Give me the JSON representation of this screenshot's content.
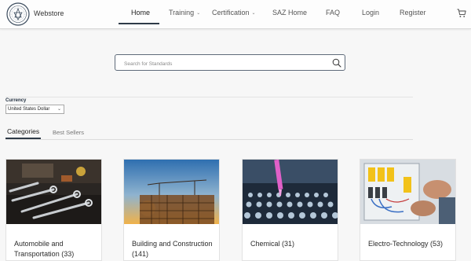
{
  "header": {
    "brand": "Webstore",
    "logo_icon": "seal-logo",
    "nav": [
      {
        "label": "Home",
        "active": true
      },
      {
        "label": "Training",
        "dropdown": true
      },
      {
        "label": "Certification",
        "dropdown": true
      },
      {
        "label": "SAZ Home"
      },
      {
        "label": "FAQ"
      },
      {
        "label": "Login"
      },
      {
        "label": "Register"
      }
    ],
    "cart_icon": "cart-icon"
  },
  "search": {
    "placeholder": "Search for Standards",
    "value": "",
    "icon": "search-icon"
  },
  "currency": {
    "label": "Currency",
    "selected": "United States Dollar"
  },
  "tabs": [
    {
      "label": "Categories",
      "active": true
    },
    {
      "label": "Best Sellers",
      "active": false
    }
  ],
  "categories": [
    {
      "title": "Automobile and Transportation (33)",
      "image": "tools-on-engine"
    },
    {
      "title": "Building and Construction (141)",
      "image": "construction-site-crane"
    },
    {
      "title": "Chemical (31)",
      "image": "lab-pipette-tray"
    },
    {
      "title": "Electro-Technology (53)",
      "image": "electrician-wiring-panel"
    }
  ],
  "colors": {
    "accent": "#2f3b48",
    "background": "#f7f7f7",
    "search_border": "#5f6b7a"
  }
}
